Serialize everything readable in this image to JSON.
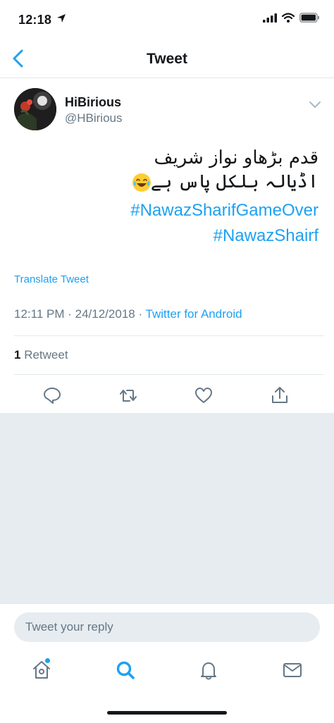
{
  "status_bar": {
    "time": "12:18"
  },
  "nav": {
    "title": "Tweet"
  },
  "tweet": {
    "display_name": "HiBirious",
    "handle": "@HBirious",
    "text_lines": [
      "قدم بڑھاو نواز شریف",
      "اڈیالہ بلکل پاس ہے"
    ],
    "hashtags": [
      "#NawazSharifGameOver",
      "#NawazShairf"
    ],
    "translate_label": "Translate Tweet",
    "time": "12:11 PM",
    "date": "24/12/2018",
    "source": "Twitter for Android",
    "retweet_count": "1",
    "retweet_label": "Retweet"
  },
  "reply": {
    "placeholder": "Tweet your reply"
  },
  "colors": {
    "accent": "#1da1f2",
    "muted": "#657786",
    "background_gray": "#e6ecf0"
  },
  "icons": {
    "actions": [
      "reply-icon",
      "retweet-icon",
      "like-icon",
      "share-icon"
    ],
    "tabs": [
      "home-icon",
      "search-icon",
      "notifications-icon",
      "messages-icon"
    ]
  }
}
